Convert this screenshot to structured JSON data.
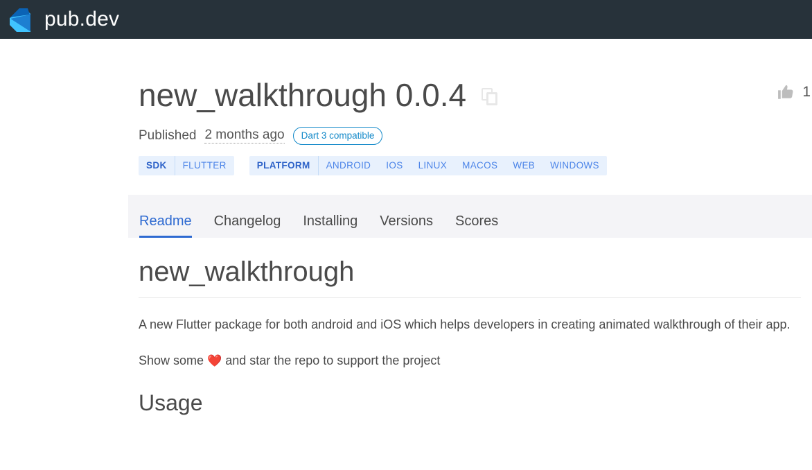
{
  "header": {
    "brand_name": "pub.dev",
    "logo_icon": "dart-logo-icon",
    "logo_colors": {
      "light": "#40c4ff",
      "mid": "#1d7fd1",
      "dark": "#0b63b5"
    },
    "background": "#27323a"
  },
  "package": {
    "title": "new_walkthrough 0.0.4",
    "name": "new_walkthrough",
    "version": "0.0.4",
    "copy_icon": "copy-icon",
    "published_label": "Published",
    "published_relative": "2 months ago",
    "dart3_badge": "Dart 3 compatible"
  },
  "tags": {
    "sdk": {
      "lead": "SDK",
      "items": [
        "FLUTTER"
      ]
    },
    "platform": {
      "lead": "PLATFORM",
      "items": [
        "ANDROID",
        "IOS",
        "LINUX",
        "MACOS",
        "WEB",
        "WINDOWS"
      ]
    }
  },
  "likes": {
    "icon": "thumb-up-icon",
    "count": "1"
  },
  "tabs": [
    {
      "label": "Readme",
      "active": true
    },
    {
      "label": "Changelog",
      "active": false
    },
    {
      "label": "Installing",
      "active": false
    },
    {
      "label": "Versions",
      "active": false
    },
    {
      "label": "Scores",
      "active": false
    }
  ],
  "readme": {
    "heading": "new_walkthrough",
    "paragraph1": "A new Flutter package for both android and iOS which helps developers in creating animated walkthrough of their app.",
    "support_prefix": "Show some ",
    "support_heart": "❤️",
    "support_suffix": " and star the repo to support the project",
    "section_usage": "Usage"
  },
  "colors": {
    "accent_blue": "#2e6ad1",
    "tag_bg": "#e8f1fd",
    "tab_bg": "#f4f4f7",
    "text": "#4a4a4a"
  }
}
